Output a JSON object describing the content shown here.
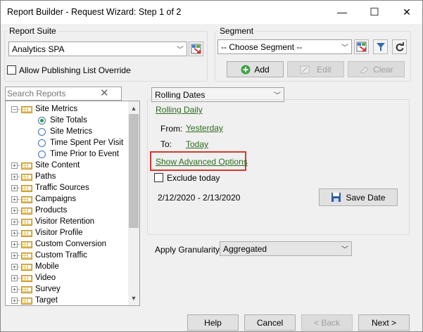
{
  "window": {
    "title": "Report Builder - Request Wizard: Step 1 of 2",
    "minimize_glyph": "—",
    "maximize_glyph": "☐",
    "close_glyph": "✕"
  },
  "report_suite": {
    "legend": "Report Suite",
    "selected": "Analytics SPA",
    "allow_override_label": "Allow Publishing List Override"
  },
  "segment": {
    "legend": "Segment",
    "placeholder": "-- Choose Segment --",
    "add_label": "Add",
    "edit_label": "Edit",
    "clear_label": "Clear"
  },
  "search": {
    "placeholder": "Search Reports",
    "clear_glyph": "✕"
  },
  "tree": {
    "items": [
      {
        "label": "Site Metrics",
        "kind": "folder",
        "expanded": true
      },
      {
        "label": "Site Totals",
        "kind": "radio",
        "selected": true
      },
      {
        "label": "Site Metrics",
        "kind": "radio",
        "selected": false
      },
      {
        "label": "Time Spent Per Visit",
        "kind": "radio",
        "selected": false
      },
      {
        "label": "Time Prior to Event",
        "kind": "radio",
        "selected": false
      },
      {
        "label": "Site Content",
        "kind": "folder"
      },
      {
        "label": "Paths",
        "kind": "folder"
      },
      {
        "label": "Traffic Sources",
        "kind": "folder"
      },
      {
        "label": "Campaigns",
        "kind": "folder"
      },
      {
        "label": "Products",
        "kind": "folder"
      },
      {
        "label": "Visitor Retention",
        "kind": "folder"
      },
      {
        "label": "Visitor Profile",
        "kind": "folder"
      },
      {
        "label": "Custom Conversion",
        "kind": "folder"
      },
      {
        "label": "Custom Traffic",
        "kind": "folder"
      },
      {
        "label": "Mobile",
        "kind": "folder"
      },
      {
        "label": "Video",
        "kind": "folder"
      },
      {
        "label": "Survey",
        "kind": "folder"
      },
      {
        "label": "Target",
        "kind": "folder"
      }
    ]
  },
  "dates": {
    "mode": "Rolling Dates",
    "preset": "Rolling Daily",
    "from_label": "From:",
    "from_value": "Yesterday",
    "to_label": "To:",
    "to_value": "Today",
    "advanced_link": "Show Advanced Options",
    "exclude_today_label": "Exclude today",
    "range_text": "2/12/2020 - 2/13/2020",
    "save_date_label": "Save Date"
  },
  "granularity": {
    "label": "Apply Granularity",
    "selected": "Aggregated"
  },
  "footer": {
    "help_label": "Help",
    "cancel_label": "Cancel",
    "back_label": "< Back",
    "next_label": "Next >"
  },
  "colors": {
    "link": "#2e6b1f",
    "highlight": "#d9382c",
    "folder": "#e8c25a",
    "accent_blue": "#2e6bb5"
  }
}
